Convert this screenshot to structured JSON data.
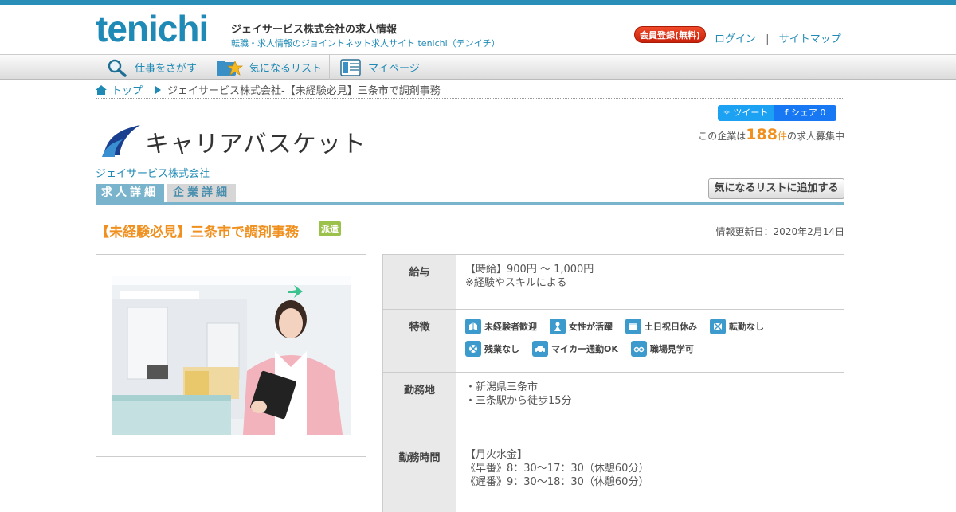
{
  "header": {
    "logo_text": "tenichi",
    "site_title": "ジェイサービス株式会社の求人情報",
    "site_subtitle": "転職・求人情報のジョイントネット求人サイト tenichi（テンイチ）",
    "register_label": "会員登録(無料)",
    "login_label": "ログイン",
    "separator": "|",
    "sitemap_label": "サイトマップ"
  },
  "nav": {
    "items": [
      {
        "label": "仕事をさがす",
        "icon": "magnifier-icon"
      },
      {
        "label": "気になるリスト",
        "icon": "star-folder-icon"
      },
      {
        "label": "マイページ",
        "icon": "id-card-icon"
      }
    ]
  },
  "breadcrumb": {
    "home_label": "トップ",
    "current": "ジェイサービス株式会社-【未経験必見】三条市で調剤事務"
  },
  "social": {
    "tweet_label": "ツイート",
    "share_label": "シェア 0"
  },
  "company": {
    "logo_text": "キャリアバスケット",
    "name": "ジェイサービス株式会社",
    "count_prefix": "この企業は",
    "count_value": "188",
    "count_unit": "件",
    "count_suffix": "の求人募集中"
  },
  "tabs": {
    "job_detail": "求人詳細",
    "company_detail": "企業詳細"
  },
  "add_list_label": "気になるリストに追加する",
  "job": {
    "title": "【未経験必見】三条市で調剤事務",
    "type_badge": "派遣",
    "updated": "情報更新日：2020年2月14日"
  },
  "details": {
    "salary": {
      "label": "給与",
      "lines": [
        "【時給】900円 ～ 1,000円",
        "※経験やスキルによる"
      ]
    },
    "features": {
      "label": "特徴",
      "items": [
        {
          "label": "未経験者歓迎",
          "icon": "beginner-icon"
        },
        {
          "label": "女性が活躍",
          "icon": "woman-icon"
        },
        {
          "label": "土日祝日休み",
          "icon": "calendar-icon"
        },
        {
          "label": "転勤なし",
          "icon": "no-transfer-icon"
        },
        {
          "label": "残業なし",
          "icon": "no-overtime-icon"
        },
        {
          "label": "マイカー通勤OK",
          "icon": "car-icon"
        },
        {
          "label": "職場見学可",
          "icon": "glasses-icon"
        }
      ]
    },
    "location": {
      "label": "勤務地",
      "lines": [
        "・新潟県三条市",
        "・三条駅から徒歩15分"
      ]
    },
    "hours": {
      "label": "勤務時間",
      "lines": [
        "【月火水金】",
        "《早番》8：30～17：30（休憩60分）",
        "《遅番》9：30～18：30（休憩60分）"
      ]
    }
  },
  "colors": {
    "brand_blue": "#1f8ab5",
    "accent_orange": "#f0901e",
    "badge_green": "#9bc14a",
    "tab_blue": "#7ab3cc"
  }
}
